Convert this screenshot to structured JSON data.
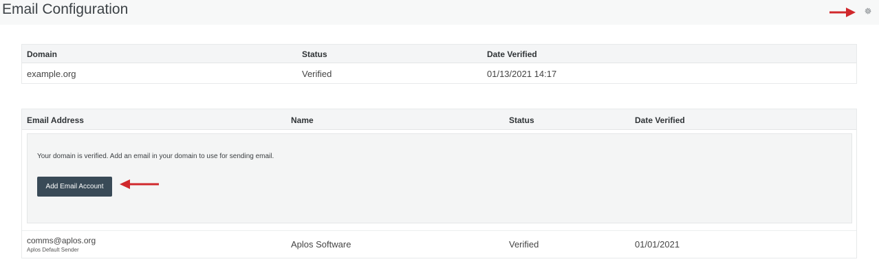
{
  "header": {
    "title": "Email Configuration",
    "settings_icon": "gear-icon"
  },
  "annotations": {
    "arrow_color": "#d0282c"
  },
  "domain_table": {
    "headers": [
      "Domain",
      "Status",
      "Date Verified"
    ],
    "rows": [
      {
        "domain": "example.org",
        "status": "Verified",
        "date_verified": "01/13/2021 14:17"
      }
    ]
  },
  "email_table": {
    "headers": [
      "Email Address",
      "Name",
      "Status",
      "Date Verified"
    ],
    "notice": "Your domain is verified. Add an email in your domain to use for sending email.",
    "add_button_label": "Add Email Account",
    "rows": [
      {
        "email": "comms@aplos.org",
        "sublabel": "Aplos Default Sender",
        "name": "Aplos Software",
        "status": "Verified",
        "date_verified": "01/01/2021"
      }
    ]
  },
  "colors": {
    "button_bg": "#394a57",
    "header_bg": "#f4f5f6"
  }
}
